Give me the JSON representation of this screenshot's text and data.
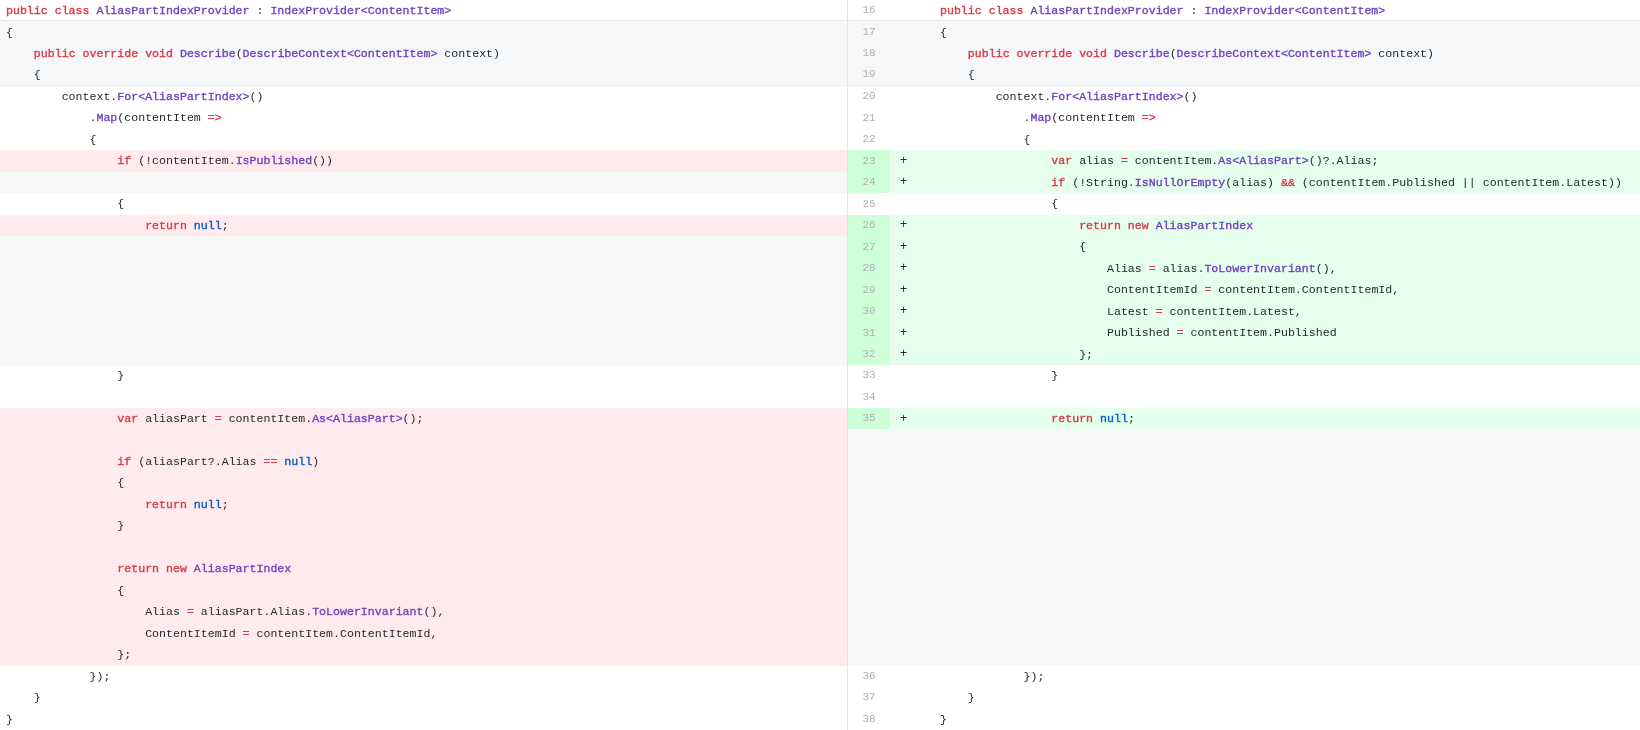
{
  "rows": [
    {
      "left": {
        "kind": "context",
        "code": [
          {
            "t": "public class ",
            "color": "#d73a49"
          },
          {
            "t": "AliasPartIndexProvider",
            "color": "#6f42c1"
          },
          {
            "t": " : "
          },
          {
            "t": "IndexProvider<ContentItem>",
            "color": "#6f42c1"
          }
        ]
      },
      "right": {
        "kind": "context",
        "number": "16",
        "code": [
          {
            "t": "public class ",
            "color": "#d73a49"
          },
          {
            "t": "AliasPartIndexProvider",
            "color": "#6f42c1"
          },
          {
            "t": " : "
          },
          {
            "t": "IndexProvider<ContentItem>",
            "color": "#6f42c1"
          }
        ]
      }
    },
    {
      "left": {
        "kind": "band",
        "code": [
          {
            "t": "{"
          }
        ]
      },
      "right": {
        "kind": "band",
        "number": "17",
        "code": [
          {
            "t": "{"
          }
        ]
      }
    },
    {
      "left": {
        "kind": "band",
        "code": [
          {
            "t": "    public override void ",
            "color": "#d73a49"
          },
          {
            "t": "Describe",
            "color": "#6f42c1"
          },
          {
            "t": "("
          },
          {
            "t": "DescribeContext<ContentItem>",
            "color": "#6f42c1"
          },
          {
            "t": " context)"
          }
        ]
      },
      "right": {
        "kind": "band",
        "number": "18",
        "code": [
          {
            "t": "    public override void ",
            "color": "#d73a49"
          },
          {
            "t": "Describe",
            "color": "#6f42c1"
          },
          {
            "t": "("
          },
          {
            "t": "DescribeContext<ContentItem>",
            "color": "#6f42c1"
          },
          {
            "t": " context)"
          }
        ]
      }
    },
    {
      "left": {
        "kind": "band",
        "code": [
          {
            "t": "    {"
          }
        ]
      },
      "right": {
        "kind": "band",
        "number": "19",
        "code": [
          {
            "t": "    {"
          }
        ]
      }
    },
    {
      "left": {
        "kind": "context",
        "code": [
          {
            "t": "        context."
          },
          {
            "t": "For<AliasPartIndex>",
            "color": "#6f42c1"
          },
          {
            "t": "()"
          }
        ]
      },
      "right": {
        "kind": "context",
        "number": "20",
        "code": [
          {
            "t": "        context."
          },
          {
            "t": "For<AliasPartIndex>",
            "color": "#6f42c1"
          },
          {
            "t": "()"
          }
        ]
      }
    },
    {
      "left": {
        "kind": "context",
        "code": [
          {
            "t": "            ."
          },
          {
            "t": "Map",
            "color": "#6f42c1"
          },
          {
            "t": "(contentItem "
          },
          {
            "t": "=>",
            "color": "#d73a49"
          }
        ]
      },
      "right": {
        "kind": "context",
        "number": "21",
        "code": [
          {
            "t": "            ."
          },
          {
            "t": "Map",
            "color": "#6f42c1"
          },
          {
            "t": "(contentItem "
          },
          {
            "t": "=>",
            "color": "#d73a49"
          }
        ]
      }
    },
    {
      "left": {
        "kind": "context",
        "code": [
          {
            "t": "            {"
          }
        ]
      },
      "right": {
        "kind": "context",
        "number": "22",
        "code": [
          {
            "t": "            {"
          }
        ]
      }
    },
    {
      "left": {
        "kind": "deleted",
        "code": [
          {
            "t": "                if",
            "color": "#d73a49"
          },
          {
            "t": " (!contentItem."
          },
          {
            "t": "IsPublished",
            "color": "#6f42c1"
          },
          {
            "t": "())"
          }
        ]
      },
      "right": {
        "kind": "added",
        "number": "23",
        "sign": "+",
        "code": [
          {
            "t": "                var",
            "color": "#d73a49"
          },
          {
            "t": " alias "
          },
          {
            "t": "=",
            "color": "#d73a49"
          },
          {
            "t": " contentItem."
          },
          {
            "t": "As<AliasPart>",
            "color": "#6f42c1"
          },
          {
            "t": "()?.Alias;"
          }
        ]
      }
    },
    {
      "left": {
        "kind": "filler"
      },
      "right": {
        "kind": "added",
        "number": "24",
        "sign": "+",
        "code": [
          {
            "t": "                if",
            "color": "#d73a49"
          },
          {
            "t": " (!String."
          },
          {
            "t": "IsNullOrEmpty",
            "color": "#6f42c1"
          },
          {
            "t": "(alias) "
          },
          {
            "t": "&&",
            "color": "#d73a49"
          },
          {
            "t": " (contentItem.Published || contentItem.Latest))"
          }
        ]
      }
    },
    {
      "left": {
        "kind": "context",
        "code": [
          {
            "t": "                {"
          }
        ]
      },
      "right": {
        "kind": "context",
        "number": "25",
        "code": [
          {
            "t": "                {"
          }
        ]
      }
    },
    {
      "left": {
        "kind": "deleted",
        "code": [
          {
            "t": "                    return ",
            "color": "#d73a49"
          },
          {
            "t": "null",
            "color": "#005cc5"
          },
          {
            "t": ";"
          }
        ]
      },
      "right": {
        "kind": "added",
        "number": "26",
        "sign": "+",
        "code": [
          {
            "t": "                    return new ",
            "color": "#d73a49"
          },
          {
            "t": "AliasPartIndex",
            "color": "#6f42c1"
          }
        ]
      }
    },
    {
      "left": {
        "kind": "filler"
      },
      "right": {
        "kind": "added",
        "number": "27",
        "sign": "+",
        "code": [
          {
            "t": "                    {"
          }
        ]
      }
    },
    {
      "left": {
        "kind": "filler"
      },
      "right": {
        "kind": "added",
        "number": "28",
        "sign": "+",
        "code": [
          {
            "t": "                        Alias "
          },
          {
            "t": "=",
            "color": "#d73a49"
          },
          {
            "t": " alias."
          },
          {
            "t": "ToLowerInvariant",
            "color": "#6f42c1"
          },
          {
            "t": "(),"
          }
        ]
      }
    },
    {
      "left": {
        "kind": "filler"
      },
      "right": {
        "kind": "added",
        "number": "29",
        "sign": "+",
        "code": [
          {
            "t": "                        ContentItemId "
          },
          {
            "t": "=",
            "color": "#d73a49"
          },
          {
            "t": " contentItem.ContentItemId,"
          }
        ]
      }
    },
    {
      "left": {
        "kind": "filler"
      },
      "right": {
        "kind": "added",
        "number": "30",
        "sign": "+",
        "code": [
          {
            "t": "                        Latest "
          },
          {
            "t": "=",
            "color": "#d73a49"
          },
          {
            "t": " contentItem.Latest,"
          }
        ]
      }
    },
    {
      "left": {
        "kind": "filler"
      },
      "right": {
        "kind": "added",
        "number": "31",
        "sign": "+",
        "code": [
          {
            "t": "                        Published "
          },
          {
            "t": "=",
            "color": "#d73a49"
          },
          {
            "t": " contentItem.Published"
          }
        ]
      }
    },
    {
      "left": {
        "kind": "filler"
      },
      "right": {
        "kind": "added",
        "number": "32",
        "sign": "+",
        "code": [
          {
            "t": "                    };"
          }
        ]
      }
    },
    {
      "left": {
        "kind": "context",
        "code": [
          {
            "t": "                }"
          }
        ]
      },
      "right": {
        "kind": "context",
        "number": "33",
        "code": [
          {
            "t": "                }"
          }
        ]
      }
    },
    {
      "left": {
        "kind": "context"
      },
      "right": {
        "kind": "context",
        "number": "34"
      }
    },
    {
      "left": {
        "kind": "deleted",
        "code": [
          {
            "t": "                var",
            "color": "#d73a49"
          },
          {
            "t": " aliasPart "
          },
          {
            "t": "=",
            "color": "#d73a49"
          },
          {
            "t": " contentItem."
          },
          {
            "t": "As<AliasPart>",
            "color": "#6f42c1"
          },
          {
            "t": "();"
          }
        ]
      },
      "right": {
        "kind": "added",
        "number": "35",
        "sign": "+",
        "code": [
          {
            "t": "                return ",
            "color": "#d73a49"
          },
          {
            "t": "null",
            "color": "#005cc5"
          },
          {
            "t": ";"
          }
        ]
      }
    },
    {
      "left": {
        "kind": "deleted"
      },
      "right": {
        "kind": "filler"
      }
    },
    {
      "left": {
        "kind": "deleted",
        "code": [
          {
            "t": "                if",
            "color": "#d73a49"
          },
          {
            "t": " (aliasPart?.Alias "
          },
          {
            "t": "== ",
            "color": "#d73a49"
          },
          {
            "t": "null",
            "color": "#005cc5"
          },
          {
            "t": ")"
          }
        ]
      },
      "right": {
        "kind": "filler"
      }
    },
    {
      "left": {
        "kind": "deleted",
        "code": [
          {
            "t": "                {"
          }
        ]
      },
      "right": {
        "kind": "filler"
      }
    },
    {
      "left": {
        "kind": "deleted",
        "code": [
          {
            "t": "                    return ",
            "color": "#d73a49"
          },
          {
            "t": "null",
            "color": "#005cc5"
          },
          {
            "t": ";"
          }
        ]
      },
      "right": {
        "kind": "filler"
      }
    },
    {
      "left": {
        "kind": "deleted",
        "code": [
          {
            "t": "                }"
          }
        ]
      },
      "right": {
        "kind": "filler"
      }
    },
    {
      "left": {
        "kind": "deleted"
      },
      "right": {
        "kind": "filler"
      }
    },
    {
      "left": {
        "kind": "deleted",
        "code": [
          {
            "t": "                return new ",
            "color": "#d73a49"
          },
          {
            "t": "AliasPartIndex",
            "color": "#6f42c1"
          }
        ]
      },
      "right": {
        "kind": "filler"
      }
    },
    {
      "left": {
        "kind": "deleted",
        "code": [
          {
            "t": "                {"
          }
        ]
      },
      "right": {
        "kind": "filler"
      }
    },
    {
      "left": {
        "kind": "deleted",
        "code": [
          {
            "t": "                    Alias "
          },
          {
            "t": "=",
            "color": "#d73a49"
          },
          {
            "t": " aliasPart.Alias."
          },
          {
            "t": "ToLowerInvariant",
            "color": "#6f42c1"
          },
          {
            "t": "(),"
          }
        ]
      },
      "right": {
        "kind": "filler"
      }
    },
    {
      "left": {
        "kind": "deleted",
        "code": [
          {
            "t": "                    ContentItemId "
          },
          {
            "t": "=",
            "color": "#d73a49"
          },
          {
            "t": " contentItem.ContentItemId,"
          }
        ]
      },
      "right": {
        "kind": "filler"
      }
    },
    {
      "left": {
        "kind": "deleted",
        "code": [
          {
            "t": "                };"
          }
        ]
      },
      "right": {
        "kind": "filler"
      }
    },
    {
      "left": {
        "kind": "context",
        "code": [
          {
            "t": "            });"
          }
        ]
      },
      "right": {
        "kind": "context",
        "number": "36",
        "code": [
          {
            "t": "            });"
          }
        ]
      }
    },
    {
      "left": {
        "kind": "context",
        "code": [
          {
            "t": "    }"
          }
        ]
      },
      "right": {
        "kind": "context",
        "number": "37",
        "code": [
          {
            "t": "    }"
          }
        ]
      }
    },
    {
      "left": {
        "kind": "context",
        "code": [
          {
            "t": "}"
          }
        ]
      },
      "right": {
        "kind": "context",
        "number": "38",
        "code": [
          {
            "t": "}"
          }
        ]
      }
    }
  ]
}
